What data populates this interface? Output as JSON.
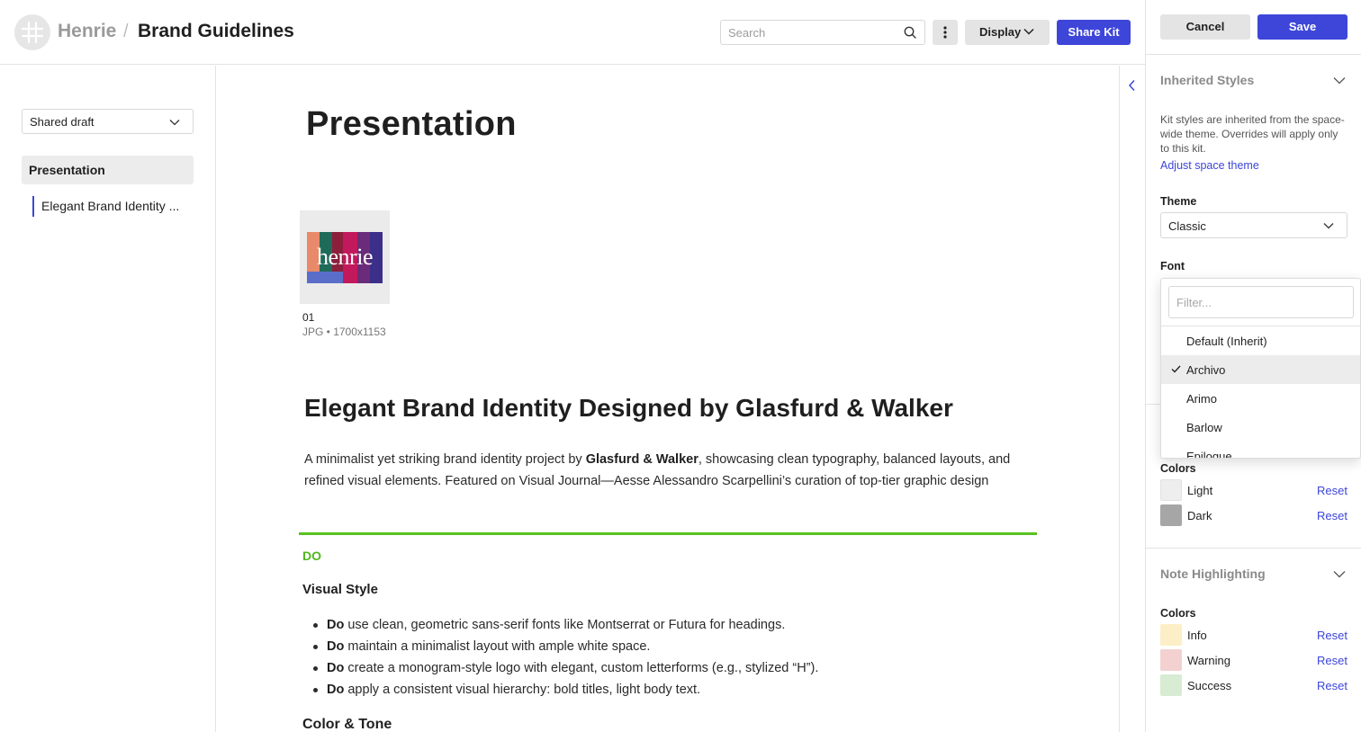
{
  "header": {
    "space_name": "Henrie",
    "separator": "/",
    "kit_title": "Brand Guidelines",
    "search_placeholder": "Search",
    "display_label": "Display",
    "share_label": "Share Kit"
  },
  "sidebar": {
    "draft_value": "Shared draft",
    "items": [
      {
        "label": "Presentation"
      },
      {
        "label": "Elegant Brand Identity ..."
      }
    ]
  },
  "main": {
    "page_title": "Presentation",
    "asset": {
      "name": "01",
      "meta": "JPG • 1700x1153",
      "image_text": "henrie"
    },
    "section_heading": "Elegant Brand Identity Designed by Glasfurd & Walker",
    "paragraph": {
      "part1": "A minimalist yet striking brand identity project by ",
      "bold": "Glasfurd & Walker",
      "part2": ", showcasing clean typography, balanced layouts, and refined visual elements. Featured on Visual Journal—Aesse Alessandro Scarpellini’s curation of top-tier graphic design"
    },
    "do_label": "DO",
    "visual_style_heading": "Visual Style",
    "do_items": [
      {
        "bold": "Do",
        "text": " use clean, geometric sans-serif fonts like Montserrat or Futura for headings."
      },
      {
        "bold": "Do",
        "text": " maintain a minimalist layout with ample white space."
      },
      {
        "bold": "Do",
        "text": " create a monogram-style logo with elegant, custom letterforms (e.g., stylized “H”)."
      },
      {
        "bold": "Do",
        "text": " apply a consistent visual hierarchy: bold titles, light body text."
      }
    ],
    "color_tone_heading": "Color & Tone"
  },
  "panel": {
    "cancel_label": "Cancel",
    "save_label": "Save",
    "inherited": {
      "title": "Inherited Styles",
      "description": "Kit styles are inherited from the space-wide theme. Overrides will apply only to this kit.",
      "link": "Adjust space theme",
      "theme_label": "Theme",
      "theme_value": "Classic",
      "font_label": "Font",
      "colors_label": "Colors",
      "colors": [
        {
          "name": "Light",
          "reset": "Reset",
          "color": "#eeeeee"
        },
        {
          "name": "Dark",
          "reset": "Reset",
          "color": "#a6a6a6"
        }
      ]
    },
    "note": {
      "title": "Note Highlighting",
      "colors_label": "Colors",
      "colors": [
        {
          "name": "Info",
          "reset": "Reset",
          "color": "#fcefc7"
        },
        {
          "name": "Warning",
          "reset": "Reset",
          "color": "#f3d1d1"
        },
        {
          "name": "Success",
          "reset": "Reset",
          "color": "#d7ecd3"
        }
      ]
    }
  },
  "font_dropdown": {
    "filter_placeholder": "Filter...",
    "options": [
      "Default (Inherit)",
      "Archivo",
      "Arimo",
      "Barlow",
      "Epilogue"
    ],
    "selected": "Archivo"
  },
  "colors": {
    "accent": "#3d46d9",
    "do_green": "#4fb81d"
  }
}
